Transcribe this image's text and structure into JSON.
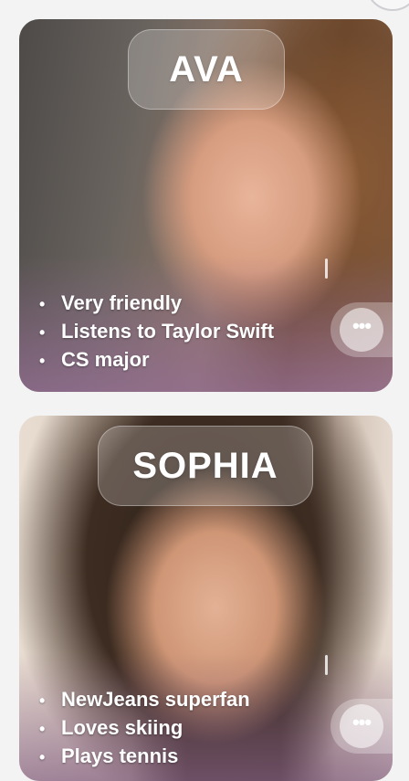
{
  "profiles": [
    {
      "name": "AVA",
      "traits": [
        "Very friendly",
        "Listens to Taylor Swift",
        "CS major"
      ],
      "more_icon": "more-horizontal-icon"
    },
    {
      "name": "SOPHIA",
      "traits": [
        "NewJeans superfan",
        "Loves skiing",
        "Plays tennis"
      ],
      "more_icon": "more-horizontal-icon"
    }
  ],
  "glyphs": {
    "bullet": "•",
    "more": "•••"
  }
}
